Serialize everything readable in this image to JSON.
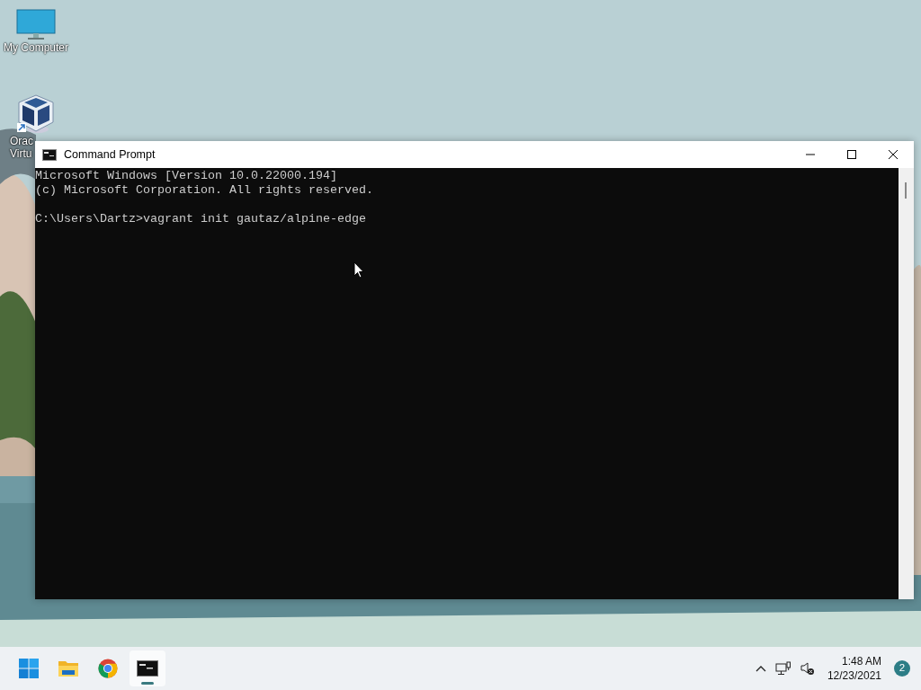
{
  "desktop_icons": [
    {
      "kind": "computer",
      "lines": [
        "My Computer"
      ]
    },
    {
      "kind": "virtualbox",
      "lines": [
        "Orac",
        "Virtu"
      ]
    }
  ],
  "window": {
    "title": "Command Prompt",
    "blocks": [
      [
        "Microsoft Windows [Version 10.0.22000.194]",
        "(c) Microsoft Corporation. All rights reserved."
      ],
      [
        "C:\\Users\\Dartz>vagrant init gautaz/alpine-edge"
      ]
    ]
  },
  "taskbar": {
    "apps": [
      {
        "kind": "start",
        "selected": false
      },
      {
        "kind": "explorer",
        "selected": false
      },
      {
        "kind": "chrome",
        "selected": false
      },
      {
        "kind": "terminal",
        "selected": true
      }
    ],
    "clock": {
      "time": "1:48 AM",
      "date": "12/23/2021"
    },
    "notification_count": "2"
  }
}
